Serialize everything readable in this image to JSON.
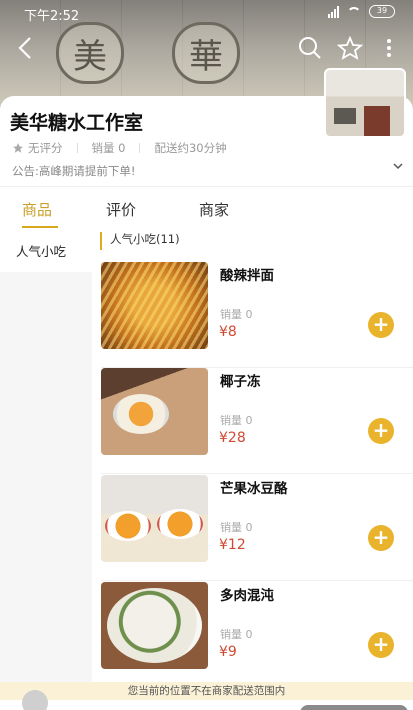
{
  "status_bar": {
    "time": "下午2:52",
    "battery": "39"
  },
  "header": {
    "sign_chars": [
      "美",
      "華"
    ],
    "colors": {
      "accent": "#d8a71e",
      "price": "#d04a32",
      "add_button": "#e9b32c"
    }
  },
  "shop": {
    "name": "美华糖水工作室",
    "rating": "无评分",
    "sales": "销量 0",
    "delivery": "配送约30分钟",
    "notice": "公告:高峰期请提前下单!"
  },
  "tabs": [
    {
      "label": "商品",
      "active": true
    },
    {
      "label": "评价",
      "active": false
    },
    {
      "label": "商家",
      "active": false
    }
  ],
  "sidebar": {
    "items": [
      {
        "label": "人气小吃"
      }
    ]
  },
  "category": {
    "title": "人气小吃(11)"
  },
  "items": [
    {
      "name": "酸辣拌面",
      "sales": "销量 0",
      "price": "¥8"
    },
    {
      "name": "椰子冻",
      "sales": "销量 0",
      "price": "¥28"
    },
    {
      "name": "芒果冰豆酪",
      "sales": "销量 0",
      "price": "¥12"
    },
    {
      "name": "多肉混沌",
      "sales": "销量 0",
      "price": "¥9"
    }
  ],
  "bottom": {
    "notice": "您当前的位置不在商家配送范围内"
  }
}
